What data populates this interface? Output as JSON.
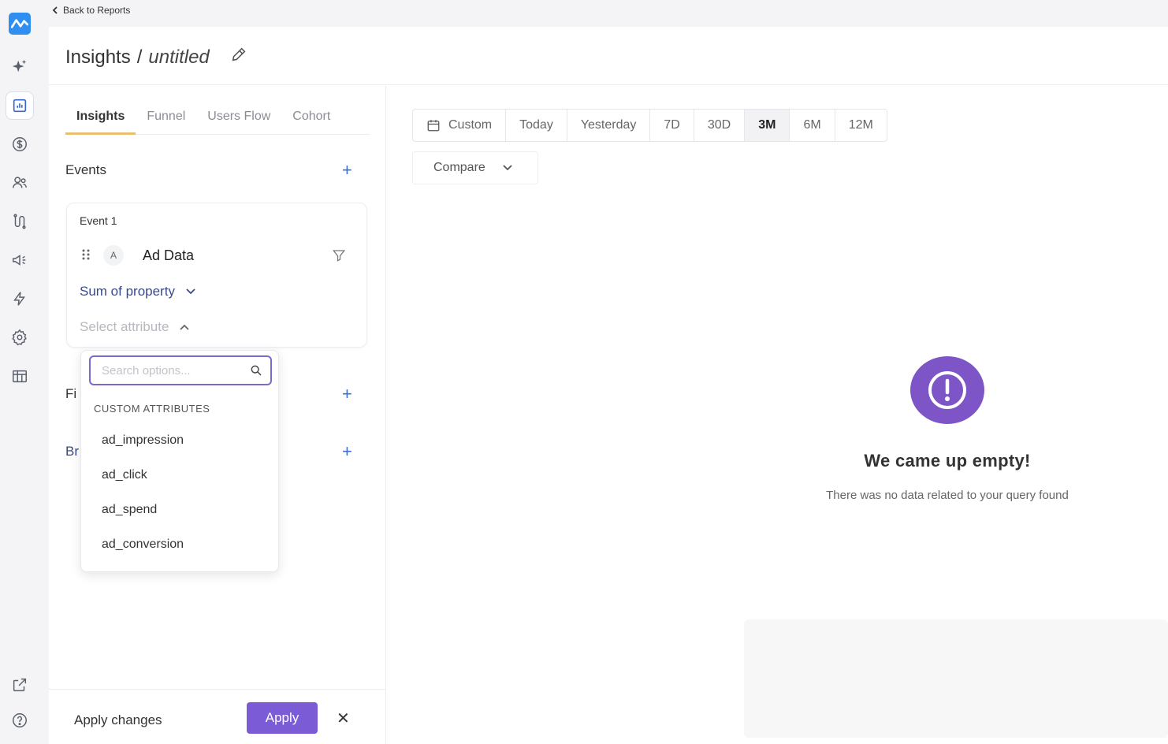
{
  "back_link": "Back to Reports",
  "header": {
    "title": "Insights",
    "separator": "/",
    "report_name": "untitled"
  },
  "tabs": [
    "Insights",
    "Funnel",
    "Users Flow",
    "Cohort"
  ],
  "sections": {
    "events": "Events",
    "filters_partial": "Fi",
    "breakdown_partial": "Br"
  },
  "event_card": {
    "label": "Event 1",
    "letter": "A",
    "name": "Ad Data",
    "aggregation": "Sum of property",
    "attribute_placeholder": "Select attribute"
  },
  "dropdown": {
    "search_placeholder": "Search options...",
    "group_header": "CUSTOM ATTRIBUTES",
    "options": [
      "ad_impression",
      "ad_click",
      "ad_spend",
      "ad_conversion"
    ]
  },
  "apply_bar": {
    "label": "Apply changes",
    "button": "Apply"
  },
  "date_range": {
    "buttons": [
      "Custom",
      "Today",
      "Yesterday",
      "7D",
      "30D",
      "3M",
      "6M",
      "12M"
    ],
    "selected": "3M"
  },
  "compare": "Compare",
  "empty_state": {
    "heading": "We came up empty!",
    "message": "There was no data related to your query found"
  },
  "colors": {
    "accent": "#7b5bd6",
    "logo": "#2f8ff0",
    "tab_underline": "#e8c070",
    "link_blue": "#3b6fd6"
  },
  "rail_icons": [
    "sparkle-icon",
    "report-icon",
    "revenue-icon",
    "users-icon",
    "flow-icon",
    "megaphone-icon",
    "bolt-icon",
    "settings-icon",
    "table-icon",
    "external-link-icon",
    "help-icon"
  ]
}
